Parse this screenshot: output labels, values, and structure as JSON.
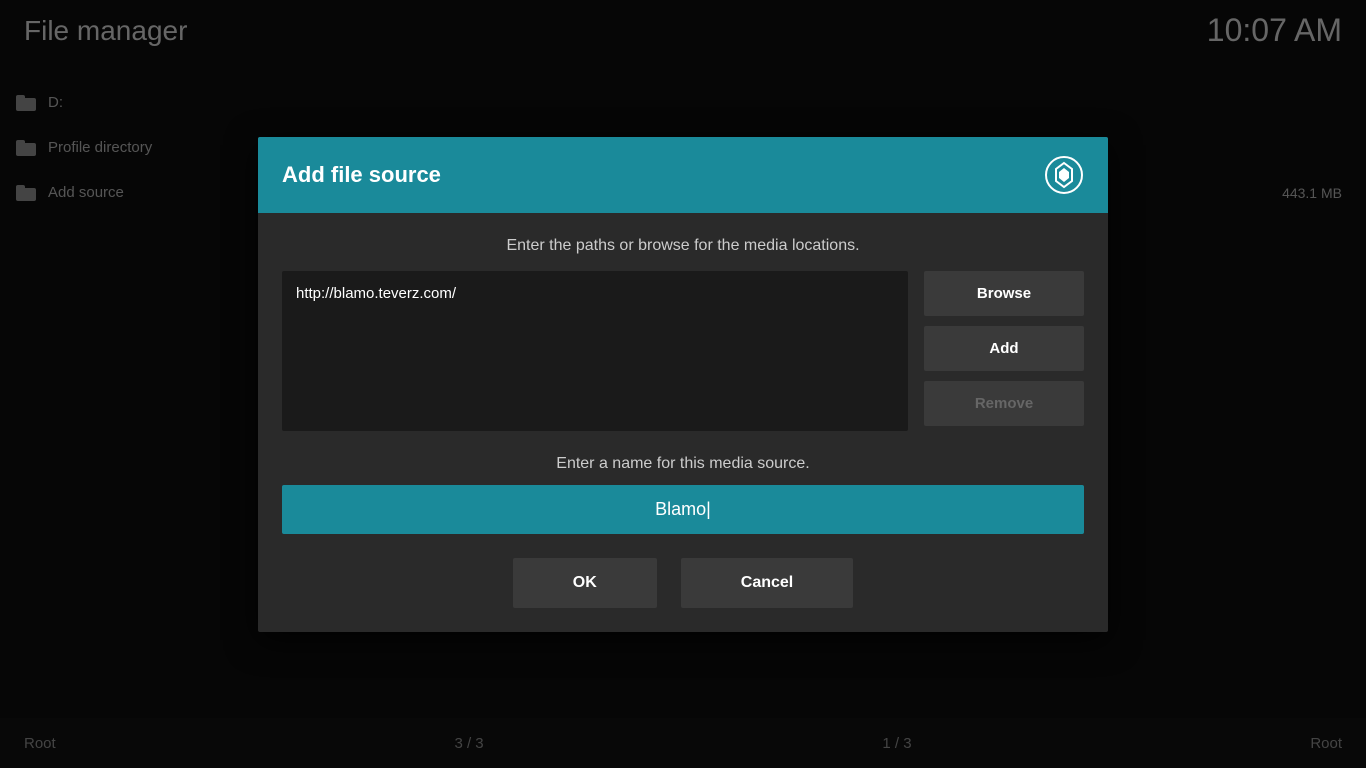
{
  "header": {
    "title": "File manager",
    "time": "10:07 AM"
  },
  "sidebar": {
    "items": [
      {
        "label": "D:",
        "icon": "folder-icon"
      },
      {
        "label": "Profile directory",
        "icon": "folder-icon"
      },
      {
        "label": "Add source",
        "icon": "folder-icon"
      }
    ]
  },
  "right_info": {
    "size": "443.1 MB"
  },
  "footer": {
    "left_label": "Root",
    "left_pages": "3 / 3",
    "right_pages": "1 / 3",
    "right_label": "Root"
  },
  "dialog": {
    "title": "Add file source",
    "instruction_path": "Enter the paths or browse for the media locations.",
    "path_value": "http://blamo.teverz.com/",
    "buttons": {
      "browse": "Browse",
      "add": "Add",
      "remove": "Remove"
    },
    "instruction_name": "Enter a name for this media source.",
    "name_value": "Blamo|",
    "ok_label": "OK",
    "cancel_label": "Cancel"
  },
  "kodi_logo": "✦"
}
